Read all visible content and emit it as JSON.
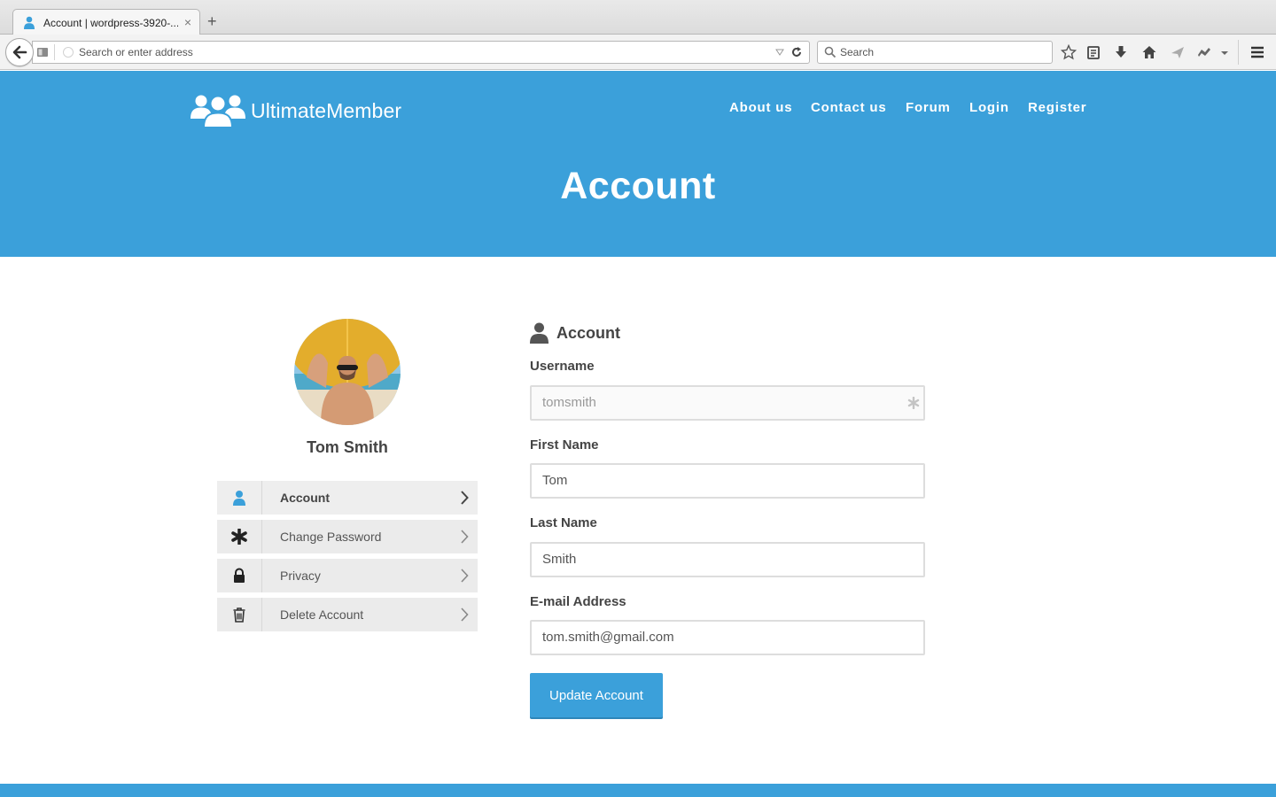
{
  "browser": {
    "tab_title": "Account | wordpress-3920-...",
    "new_tab": "+",
    "close": "×",
    "url_placeholder": "Search or enter address",
    "search_placeholder": "Search"
  },
  "site": {
    "logo_text": "UltimateMember",
    "nav": [
      "About us",
      "Contact us",
      "Forum",
      "Login",
      "Register"
    ],
    "page_title": "Account",
    "colors": {
      "brand": "#3ba0da",
      "text": "#444444"
    }
  },
  "profile": {
    "display_name": "Tom Smith",
    "avatar": "surfer-holding-board-photo"
  },
  "account_menu": [
    {
      "label": "Account",
      "icon": "user-icon",
      "active": true
    },
    {
      "label": "Change Password",
      "icon": "asterisk-icon",
      "active": false
    },
    {
      "label": "Privacy",
      "icon": "lock-icon",
      "active": false
    },
    {
      "label": "Delete Account",
      "icon": "trash-icon",
      "active": false
    }
  ],
  "form": {
    "section_title": "Account",
    "fields": {
      "username": {
        "label": "Username",
        "value": "tomsmith"
      },
      "first_name": {
        "label": "First Name",
        "value": "Tom"
      },
      "last_name": {
        "label": "Last Name",
        "value": "Smith"
      },
      "email": {
        "label": "E-mail Address",
        "value": "tom.smith@gmail.com"
      }
    },
    "submit_label": "Update Account"
  }
}
